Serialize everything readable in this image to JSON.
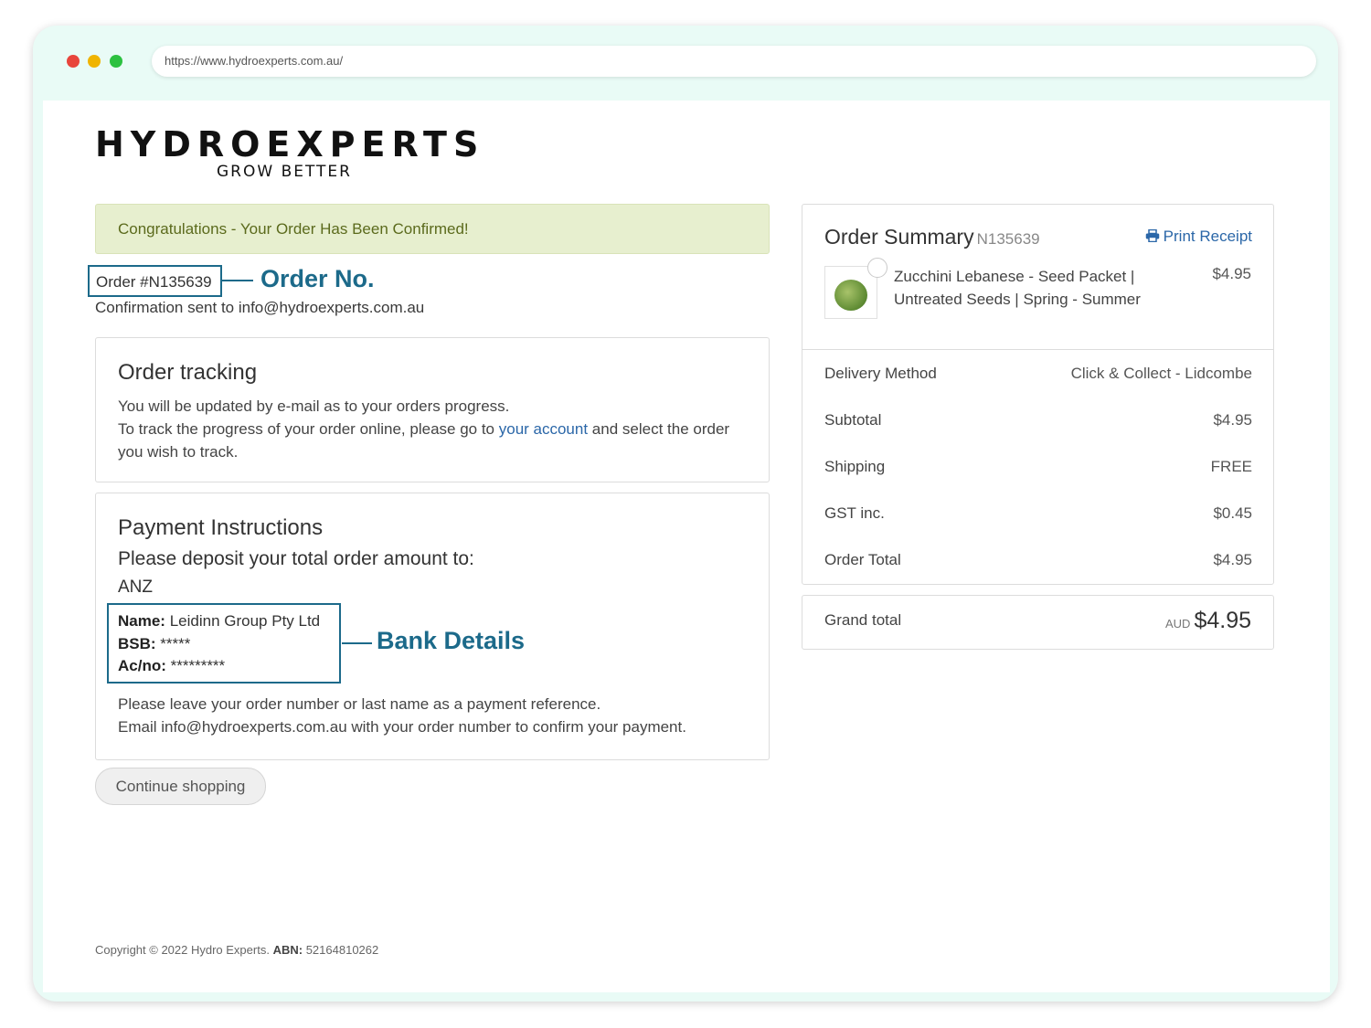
{
  "browser": {
    "url": "https://www.hydroexperts.com.au/"
  },
  "logo": {
    "main": "HYDROEXPERTS",
    "tagline": "GROW BETTER"
  },
  "alert": {
    "text": "Congratulations - Your Order Has Been Confirmed!"
  },
  "order": {
    "number_label": "Order #N135639",
    "confirmation": "Confirmation sent to info@hydroexperts.com.au"
  },
  "annotations": {
    "order_no": "Order No.",
    "bank_details": "Bank Details"
  },
  "tracking": {
    "title": "Order tracking",
    "line1": "You will be updated by e-mail as to your orders progress.",
    "line2_pre": "To track the progress of your order online, please go to ",
    "line2_link": "your account",
    "line2_post": " and select the order you wish to track."
  },
  "payment": {
    "title": "Payment Instructions",
    "subtitle": "Please deposit your total order amount to:",
    "bank": "ANZ",
    "name_label": "Name:",
    "name_value": "Leidinn Group Pty Ltd",
    "bsb_label": "BSB:",
    "bsb_value": "*****",
    "acno_label": "Ac/no:",
    "acno_value": "*********",
    "note1": "Please leave your order number or last name as a payment reference.",
    "note2": "Email info@hydroexperts.com.au with your order number to confirm your payment."
  },
  "continue_label": "Continue shopping",
  "footer": {
    "copyright": "Copyright © 2022 Hydro Experts.",
    "abn_label": "ABN:",
    "abn_value": "52164810262"
  },
  "summary": {
    "title": "Order Summary",
    "order_id": "N135639",
    "print_label": "Print Receipt",
    "product": {
      "name": "Zucchini Lebanese - Seed Packet | Untreated Seeds | Spring - Summer",
      "price": "$4.95"
    },
    "rows": [
      {
        "label": "Delivery Method",
        "value": "Click & Collect - Lidcombe"
      },
      {
        "label": "Subtotal",
        "value": "$4.95"
      },
      {
        "label": "Shipping",
        "value": "FREE"
      },
      {
        "label": "GST inc.",
        "value": "$0.45"
      },
      {
        "label": "Order Total",
        "value": "$4.95"
      }
    ],
    "grand_label": "Grand total",
    "grand_currency": "AUD",
    "grand_value": "$4.95"
  },
  "colors": {
    "annotation": "#1c6a8a",
    "link": "#2b67a8",
    "alert_bg": "#e7efcf",
    "alert_text": "#5b6a1c"
  }
}
